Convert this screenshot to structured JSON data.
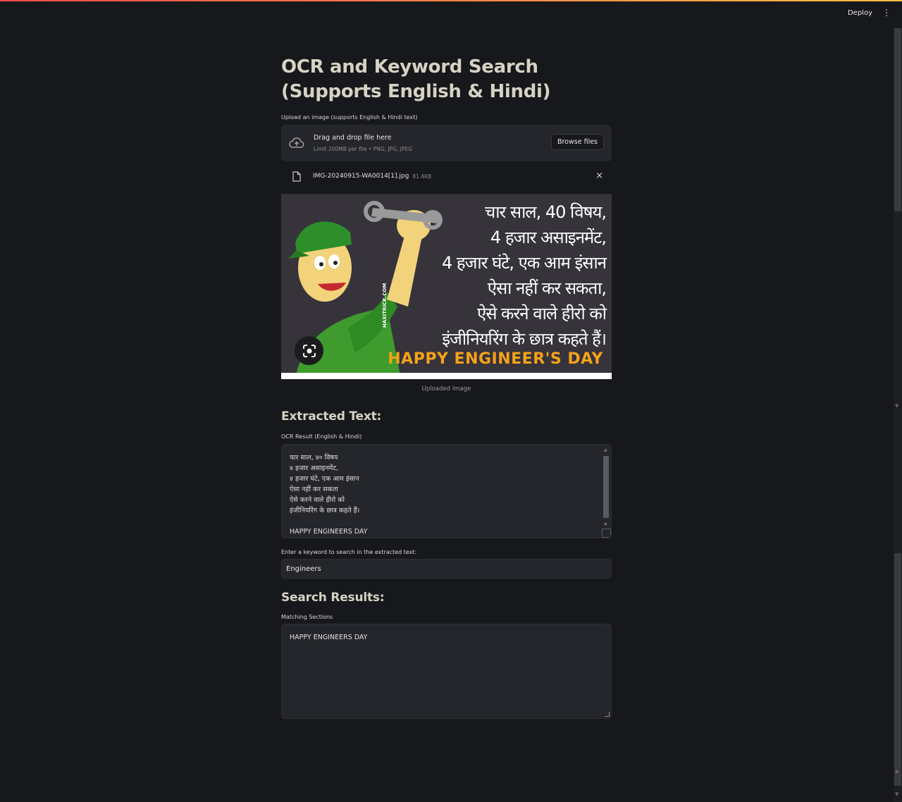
{
  "header": {
    "deploy_label": "Deploy",
    "menu_icon": "⋮"
  },
  "main": {
    "title": "OCR and Keyword Search (Supports English & Hindi)",
    "uploader": {
      "label": "Upload an image (supports English & Hindi text)",
      "drag_text": "Drag and drop file here",
      "limit_text": "Limit 200MB per file • PNG, JPG, JPEG",
      "browse_label": "Browse files",
      "file_name": "IMG-20240915-WA0014[1].jpg",
      "file_size": "81.4KB",
      "remove_icon": "×"
    },
    "image": {
      "hindi_lines": [
        "चार साल, 40 विषय,",
        "4 हजार असाइनमेंट,",
        "4 हजार घंटे, एक आम इंसान",
        "ऐसा नहीं कर सकता,",
        "ऐसे करने वाले हीरो को",
        "इंजीनियरिंग के छात्र कहते हैं।"
      ],
      "happy_text": "HAPPY ENGINEER'S DAY",
      "watermark": "HAXITRICK.COM",
      "caption": "Uploaded Image"
    },
    "extracted_heading": "Extracted Text:",
    "ocr_label": "OCR Result (English & Hindi)",
    "ocr_text": "चार साल, ४० विषय\n४ हजार असाइनमेंट,\n४ हजार घंटे, एक आम इंसान\nऐसा नहीं कर सकता\nऐसे करने वाले हीरो को\nइंजीनियरिंग के छात्र कहते हैं।\n\nHAPPY ENGINEERS DAY",
    "keyword_label": "Enter a keyword to search in the extracted text:",
    "keyword_value": "Engineers",
    "results_heading": "Search Results:",
    "matching_label": "Matching Sections",
    "matching_text": "HAPPY ENGINEERS DAY"
  },
  "colors": {
    "background": "#17181b",
    "input_bg": "#25262b",
    "heading": "#d6d2c4",
    "accent_orange": "#f5a21a",
    "top_gradient_start": "#ff4b4b",
    "top_gradient_end": "#ffbd45"
  }
}
